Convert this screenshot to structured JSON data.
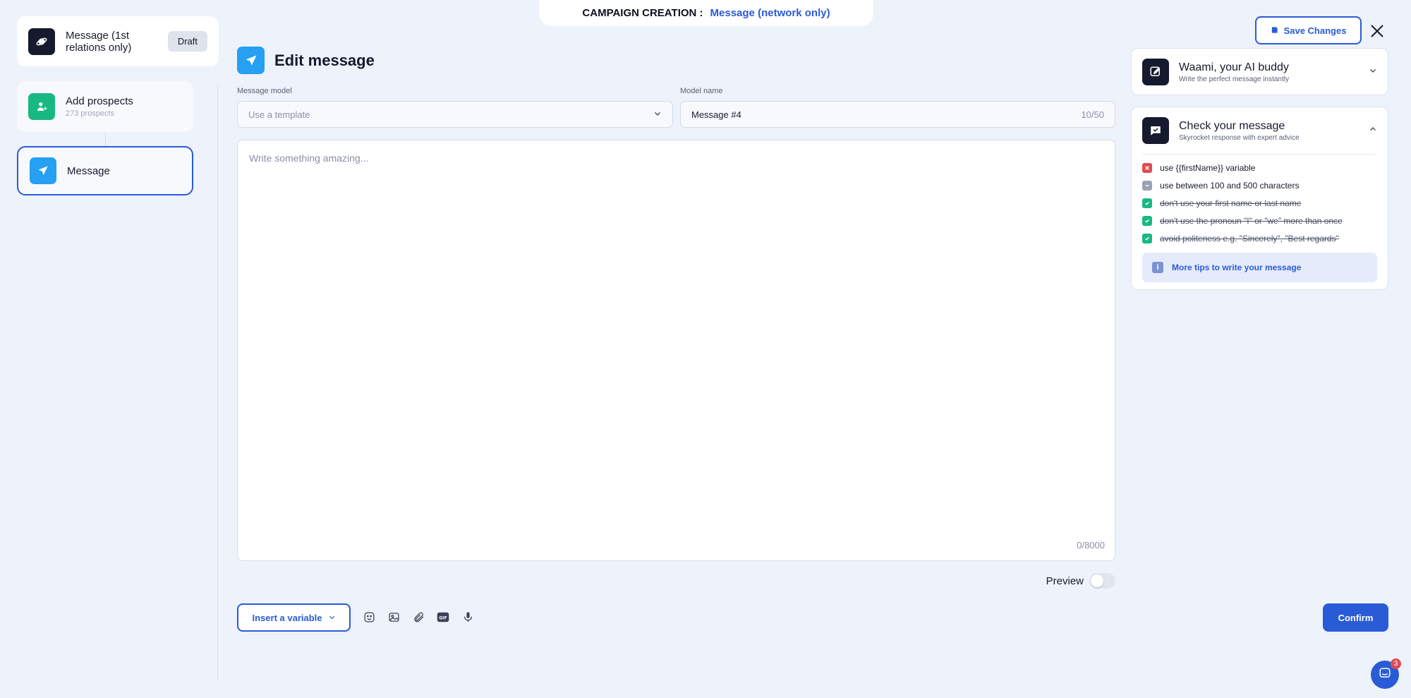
{
  "header": {
    "label": "CAMPAIGN CREATION :",
    "value": "Message (network only)"
  },
  "steps": [
    {
      "title": "Message (1st relations only)",
      "badge": "Draft",
      "icon": "planet-icon"
    },
    {
      "title": "Add prospects",
      "subtitle": "273 prospects",
      "icon": "user-add-icon"
    },
    {
      "title": "Message",
      "icon": "paper-plane-icon"
    }
  ],
  "editor": {
    "title": "Edit message",
    "model_label": "Message model",
    "model_placeholder": "Use a template",
    "name_label": "Model name",
    "name_value": "Message #4",
    "name_count": "10/50",
    "message_placeholder": "Write something amazing...",
    "message_count": "0/8000",
    "preview_label": "Preview",
    "insert_variable_label": "Insert a variable",
    "confirm_label": "Confirm",
    "tool_icons": [
      "emoji-icon",
      "image-icon",
      "attachment-icon",
      "gif-icon",
      "microphone-icon"
    ]
  },
  "actions": {
    "save_label": "Save Changes"
  },
  "ai_card": {
    "title": "Waami, your AI buddy",
    "subtitle": "Write the perfect message instantly"
  },
  "check_card": {
    "title": "Check your message",
    "subtitle": "Skyrocket response with expert advice",
    "items": [
      {
        "label": "use {{firstName}} variable",
        "state": "fail"
      },
      {
        "label": "use between 100 and 500 characters",
        "state": "neutral"
      },
      {
        "label": "don't use your first name or last name",
        "state": "pass"
      },
      {
        "label": "don't use the pronoun \"I\" or \"we\" more than once",
        "state": "pass"
      },
      {
        "label": "avoid politeness e.g. \"Sincerely\", \"Best regards\"",
        "state": "pass"
      }
    ],
    "tips_label": "More tips to write your message"
  },
  "chat": {
    "badge": "3"
  },
  "colors": {
    "accent": "#2a5bd7",
    "success": "#18b882",
    "danger": "#e04a53",
    "background": "#edf2fb"
  }
}
